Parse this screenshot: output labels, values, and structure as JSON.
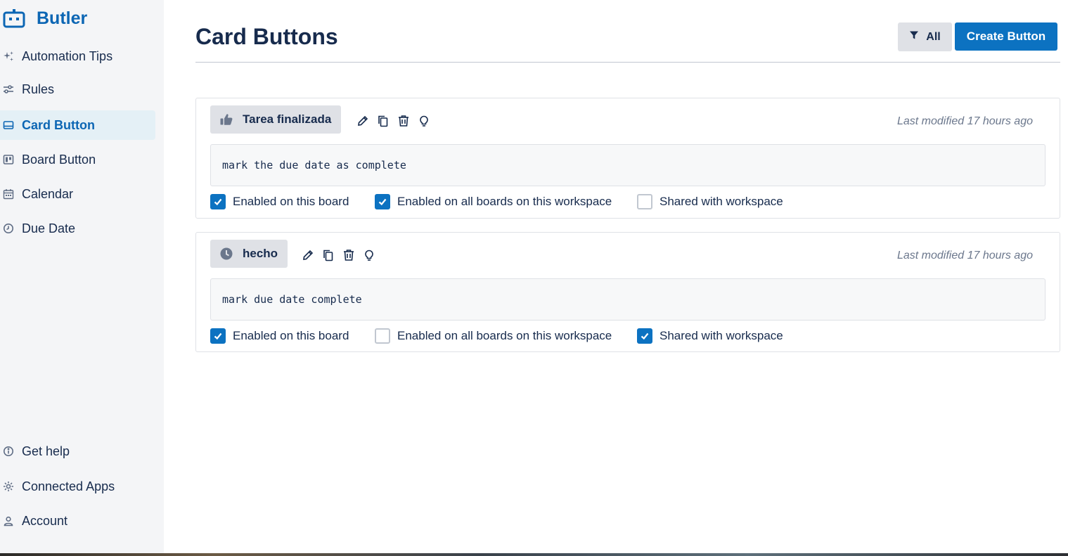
{
  "app": {
    "name": "Butler"
  },
  "sidebar": {
    "items": [
      {
        "label": "Automation Tips",
        "icon": "sparkle-icon",
        "active": false
      },
      {
        "label": "Rules",
        "icon": "sliders-icon",
        "active": false
      },
      {
        "label": "Card Button",
        "icon": "card-icon",
        "active": true
      },
      {
        "label": "Board Button",
        "icon": "board-icon",
        "active": false
      },
      {
        "label": "Calendar",
        "icon": "calendar-icon",
        "active": false
      },
      {
        "label": "Due Date",
        "icon": "clock-icon",
        "active": false
      }
    ],
    "footer_items": [
      {
        "label": "Get help",
        "icon": "info-icon"
      },
      {
        "label": "Connected Apps",
        "icon": "gear-icon"
      },
      {
        "label": "Account",
        "icon": "user-icon"
      }
    ]
  },
  "main": {
    "title": "Card Buttons",
    "filter_label": "All",
    "create_label": "Create Button"
  },
  "buttons": [
    {
      "name": "Tarea finalizada",
      "icon": "thumbs-up-icon",
      "modified": "Last modified 17 hours ago",
      "command": "mark the due date as complete",
      "options": [
        {
          "label": "Enabled on this board",
          "checked": true
        },
        {
          "label": "Enabled on all boards on this workspace",
          "checked": true
        },
        {
          "label": "Shared with workspace",
          "checked": false
        }
      ]
    },
    {
      "name": "hecho",
      "icon": "clock-icon",
      "modified": "Last modified 17 hours ago",
      "command": "mark due date complete",
      "options": [
        {
          "label": "Enabled on this board",
          "checked": true
        },
        {
          "label": "Enabled on all boards on this workspace",
          "checked": false
        },
        {
          "label": "Shared with workspace",
          "checked": true
        }
      ]
    }
  ],
  "colors": {
    "accent": "#0c72c1",
    "brand": "#0c66b4",
    "sidebar_bg": "#f4f5f7"
  }
}
